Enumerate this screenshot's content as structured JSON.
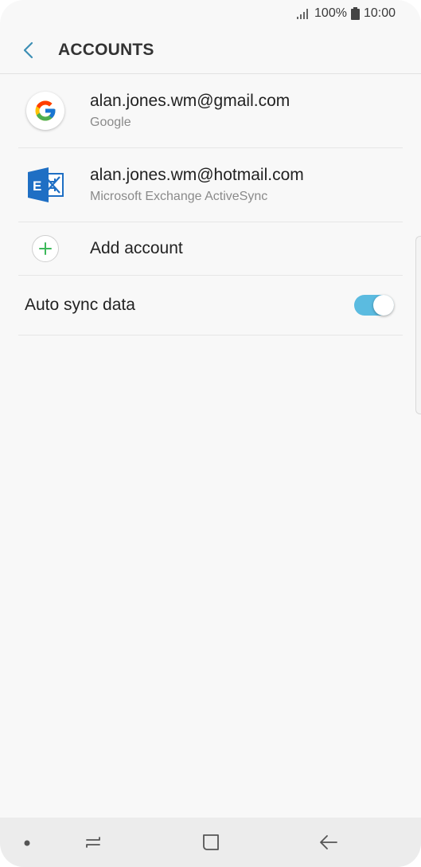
{
  "status_bar": {
    "battery": "100%",
    "time": "10:00"
  },
  "app_bar": {
    "title": "ACCOUNTS"
  },
  "accounts": [
    {
      "email": "alan.jones.wm@gmail.com",
      "type": "Google",
      "icon": "google-logo-icon"
    },
    {
      "email": "alan.jones.wm@hotmail.com",
      "type": "Microsoft Exchange ActiveSync",
      "icon": "exchange-logo-icon"
    }
  ],
  "add_account": {
    "label": "Add account",
    "icon": "plus-icon"
  },
  "auto_sync": {
    "label": "Auto sync data",
    "enabled": true
  },
  "colors": {
    "accent": "#5bbbe0",
    "plus_green": "#3cb85a",
    "exchange_blue": "#1f6fc4"
  },
  "nav_bar": {
    "icons": [
      "dot-icon",
      "recent-apps-icon",
      "home-icon",
      "back-icon"
    ]
  }
}
